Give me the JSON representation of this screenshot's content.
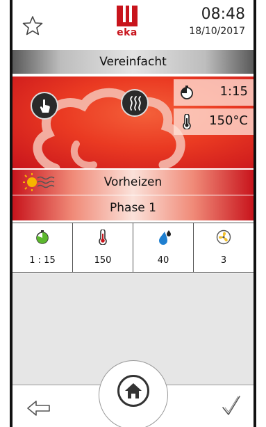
{
  "header": {
    "favorite_icon": "star-outline-icon",
    "brand": "eka",
    "time": "08:48",
    "date": "18/10/2017"
  },
  "titlebar": {
    "label": "Vereinfacht"
  },
  "program": {
    "mode_buttons": [
      "manual-touch-icon",
      "steam-icon"
    ],
    "timer": {
      "icon": "timer-icon",
      "value": "1:15"
    },
    "temperature": {
      "icon": "thermometer-icon",
      "value": "150°C"
    }
  },
  "preheat": {
    "icon": "sun-heat-icon",
    "label": "Vorheizen"
  },
  "phase": {
    "label": "Phase 1"
  },
  "parameters": [
    {
      "icon": "timer-icon",
      "value": "1 : 15"
    },
    {
      "icon": "thermometer-icon",
      "value": "150"
    },
    {
      "icon": "humidity-drop-icon",
      "value": "40"
    },
    {
      "icon": "fan-icon",
      "value": "3"
    }
  ],
  "footer": {
    "back_icon": "arrow-left-icon",
    "home_icon": "home-icon",
    "confirm_icon": "checkmark-icon"
  },
  "colors": {
    "brand_red": "#c8141c",
    "panel_orange": "#ea3a22",
    "timer_green": "#5cb82e",
    "drop_blue": "#1e7fd0",
    "fan_yellow": "#f3c12b"
  }
}
